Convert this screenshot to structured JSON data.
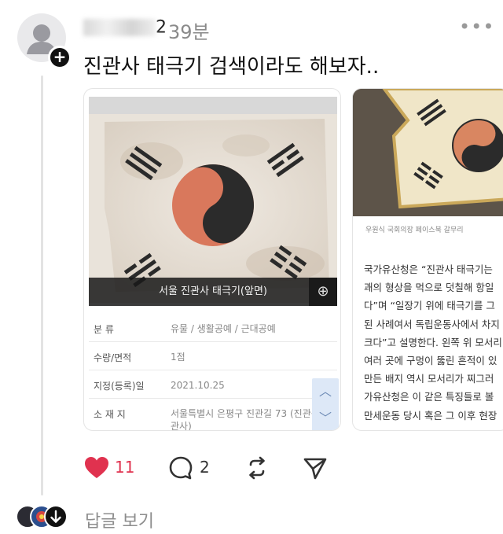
{
  "post": {
    "username_visible_suffix": "2",
    "time": "39분",
    "more_icon": "•••",
    "text": "진관사 태극기 검색이라도 해보자..",
    "follow_icon": "+"
  },
  "image1": {
    "caption": "서울 진관사 태극기(앞면)",
    "zoom_icon": "⊕",
    "table": [
      {
        "label": "분 류",
        "value": "유물 / 생활공예 / 근대공예"
      },
      {
        "label": "수량/면적",
        "value": "1점"
      },
      {
        "label": "지정(등록)일",
        "value": "2021.10.25"
      },
      {
        "label": "소 재 지",
        "value": "서울특별시 은평구 진관길 73 (진관동 관사)"
      }
    ],
    "scroll_up": "︿",
    "scroll_down": "﹀"
  },
  "image2": {
    "credit": "우원식 국회의장 페이스북 갈무리",
    "article_lines": [
      "국가유산청은 “진관사 태극기는",
      "괘의 형상을 먹으로 덧칠해 항일",
      "다”며 “일장기 위에 태극기를 그",
      "된 사례여서 독립운동사에서 차지",
      "크다”고 설명한다. 왼쪽 위 모서리",
      "여러 곳에 구멍이 뚫린 흔적이 있",
      "만든 배지 역시 모서리가 찌그러",
      "가유산청은 이 같은 특징들로 볼",
      "만세운동 당시 혹은 그 이후 현장"
    ]
  },
  "actions": {
    "like_count": "11",
    "comment_count": "2",
    "like_color": "#e0324f"
  },
  "replies": {
    "label": "답글 보기"
  }
}
